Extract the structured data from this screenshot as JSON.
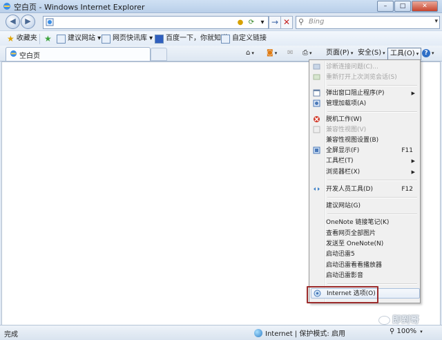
{
  "window": {
    "title": "空白页 - Windows Internet Explorer",
    "min": "–",
    "max": "□",
    "close": "✕"
  },
  "address": {
    "value": "",
    "go_symbol": "→",
    "stop_symbol": "✕",
    "refresh_symbol": "⟳"
  },
  "search": {
    "placeholder": "Bing"
  },
  "favorites_bar": {
    "favorites_label": "收藏夹",
    "items": [
      "建议网站 ▾",
      "网页快讯库 ▾",
      "百度一下，你就知道",
      "自定义链接"
    ]
  },
  "tab": {
    "label": "空白页"
  },
  "command_bar": {
    "page": "页面(P)",
    "safety": "安全(S)",
    "tools": "工具(O)",
    "help": "?"
  },
  "tools_menu": {
    "items": [
      {
        "label": "诊断连接问题(C)...",
        "disabled": true,
        "icon": "diagnose-icon"
      },
      {
        "label": "重新打开上次浏览会话(S)",
        "disabled": true,
        "icon": "reopen-icon"
      },
      {
        "label": "弹出窗口阻止程序(P)",
        "submenu": true,
        "icon": "popup-icon"
      },
      {
        "label": "管理加载项(A)",
        "icon": "addons-icon"
      },
      {
        "label": "脱机工作(W)",
        "icon": "offline-icon"
      },
      {
        "label": "兼容性视图(V)",
        "disabled": true,
        "icon": "compat-icon"
      },
      {
        "label": "兼容性视图设置(B)"
      },
      {
        "label": "全屏显示(F)",
        "accel": "F11",
        "icon": "fullscreen-icon"
      },
      {
        "label": "工具栏(T)",
        "submenu": true
      },
      {
        "label": "浏览器栏(X)",
        "submenu": true
      },
      {
        "label": "开发人员工具(D)",
        "accel": "F12",
        "icon": "devtools-icon"
      },
      {
        "label": "建议网站(G)"
      },
      {
        "label": "OneNote 链接笔记(K)"
      },
      {
        "label": "查看网页全部图片"
      },
      {
        "label": "发送至 OneNote(N)"
      },
      {
        "label": "启动迅雷5"
      },
      {
        "label": "启动迅雷看看播放器"
      },
      {
        "label": "启动迅雷影音"
      },
      {
        "label": "Internet 选项(O)",
        "icon": "internet-options-icon",
        "highlighted": true
      }
    ]
  },
  "status": {
    "text": "完成",
    "zone": "Internet | 保护模式: 启用",
    "zoom": "100%"
  },
  "watermark": {
    "text": "即到哥"
  },
  "colors": {
    "highlight_border": "#9b2a2a",
    "menu_bg": "#f0f0f0"
  }
}
